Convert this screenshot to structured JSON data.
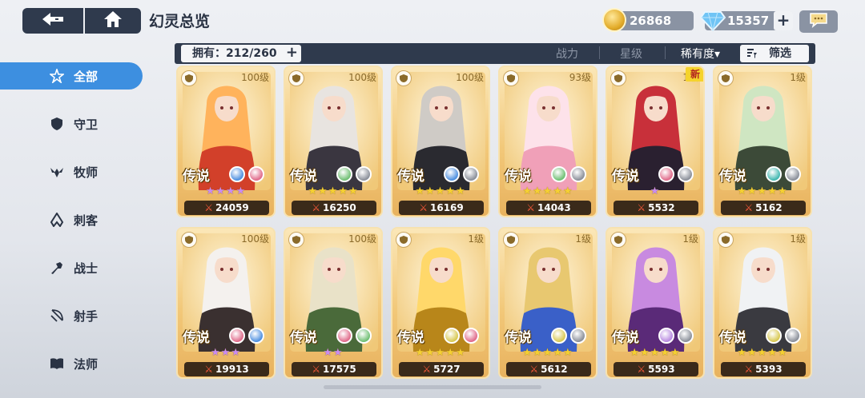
{
  "header": {
    "title": "幻灵总览",
    "gold": "26868",
    "gems": "15357",
    "gem_plus": "+"
  },
  "filterbar": {
    "owned": "拥有：212/260",
    "owned_plus": "+",
    "sort_power": "战力",
    "sort_star": "星级",
    "sort_rarity": "稀有度▾",
    "filter": "筛选"
  },
  "sidebar": {
    "items": [
      {
        "label": "全部",
        "icon": "all-icon",
        "active": true
      },
      {
        "label": "守卫",
        "icon": "shield-icon",
        "active": false
      },
      {
        "label": "牧师",
        "icon": "priest-icon",
        "active": false
      },
      {
        "label": "刺客",
        "icon": "assassin-icon",
        "active": false
      },
      {
        "label": "战士",
        "icon": "warrior-icon",
        "active": false
      },
      {
        "label": "射手",
        "icon": "archer-icon",
        "active": false
      },
      {
        "label": "法师",
        "icon": "book-icon",
        "active": false
      }
    ]
  },
  "colors": {
    "accent": "#3d8fe0",
    "dark": "#2f3a4d",
    "card_gold": "#f2c879"
  },
  "cards": [
    {
      "level": "100级",
      "rarity": "传说",
      "stars": "★★★★",
      "star_color": "#c98cf0",
      "power": "24059",
      "palette": [
        "#ffb35c",
        "#d2402a"
      ],
      "elems": [
        "#4d8fe0",
        "#e06a8a"
      ],
      "new": false
    },
    {
      "level": "100级",
      "rarity": "传说",
      "stars": "★★★★★",
      "star_color": "#f5d032",
      "power": "16250",
      "palette": [
        "#e8e4e0",
        "#3a3640"
      ],
      "elems": [
        "#6fbf73",
        "#8a8f99"
      ],
      "new": false
    },
    {
      "level": "100级",
      "rarity": "传说",
      "stars": "★★★★★",
      "star_color": "#f5d032",
      "power": "16169",
      "palette": [
        "#cfcbc6",
        "#2a2a30"
      ],
      "elems": [
        "#4d8fe0",
        "#8a8f99"
      ],
      "new": false
    },
    {
      "level": "93级",
      "rarity": "传说",
      "stars": "★★★★★",
      "star_color": "#f5d032",
      "power": "14043",
      "palette": [
        "#fde2ea",
        "#f0a0b8"
      ],
      "elems": [
        "#6fbf73",
        "#8a8f99"
      ],
      "new": false
    },
    {
      "level": "1级",
      "rarity": "传说",
      "stars": "★",
      "star_color": "#c98cf0",
      "power": "5532",
      "palette": [
        "#c8303a",
        "#2a2030"
      ],
      "elems": [
        "#e06a8a",
        "#8a8f99"
      ],
      "new": true
    },
    {
      "level": "1级",
      "rarity": "传说",
      "stars": "★★★★★",
      "star_color": "#f5d032",
      "power": "5162",
      "palette": [
        "#cfe6c2",
        "#3c4a38"
      ],
      "elems": [
        "#3fb7b0",
        "#8a8f99"
      ],
      "new": false
    },
    {
      "level": "100级",
      "rarity": "传说",
      "stars": "★★★",
      "star_color": "#c98cf0",
      "power": "19913",
      "palette": [
        "#f4f1ee",
        "#3a3030"
      ],
      "elems": [
        "#e06a8a",
        "#4d8fe0"
      ],
      "new": false
    },
    {
      "level": "100级",
      "rarity": "传说",
      "stars": "★★",
      "star_color": "#c98cf0",
      "power": "17575",
      "palette": [
        "#e9e2c8",
        "#4a6a3a"
      ],
      "elems": [
        "#e06a8a",
        "#6fbf73"
      ],
      "new": false
    },
    {
      "level": "1级",
      "rarity": "传说",
      "stars": "★★★★★",
      "star_color": "#f5d032",
      "power": "5727",
      "palette": [
        "#ffd86a",
        "#b8861a"
      ],
      "elems": [
        "#d8c850",
        "#e06a8a"
      ],
      "new": false
    },
    {
      "level": "1级",
      "rarity": "传说",
      "stars": "★★★★★",
      "star_color": "#f5d032",
      "power": "5612",
      "palette": [
        "#e8c870",
        "#3a60c8"
      ],
      "elems": [
        "#d8c850",
        "#8a8f99"
      ],
      "new": false
    },
    {
      "level": "1级",
      "rarity": "传说",
      "stars": "★★★★★",
      "star_color": "#f5d032",
      "power": "5593",
      "palette": [
        "#c88ae0",
        "#5a2a78"
      ],
      "elems": [
        "#b88ae0",
        "#8a8f99"
      ],
      "new": false
    },
    {
      "level": "1级",
      "rarity": "传说",
      "stars": "★★★★★",
      "star_color": "#f5d032",
      "power": "5393",
      "palette": [
        "#f0f2f4",
        "#3a3a40"
      ],
      "elems": [
        "#d8c850",
        "#8a8f99"
      ],
      "new": false
    }
  ]
}
